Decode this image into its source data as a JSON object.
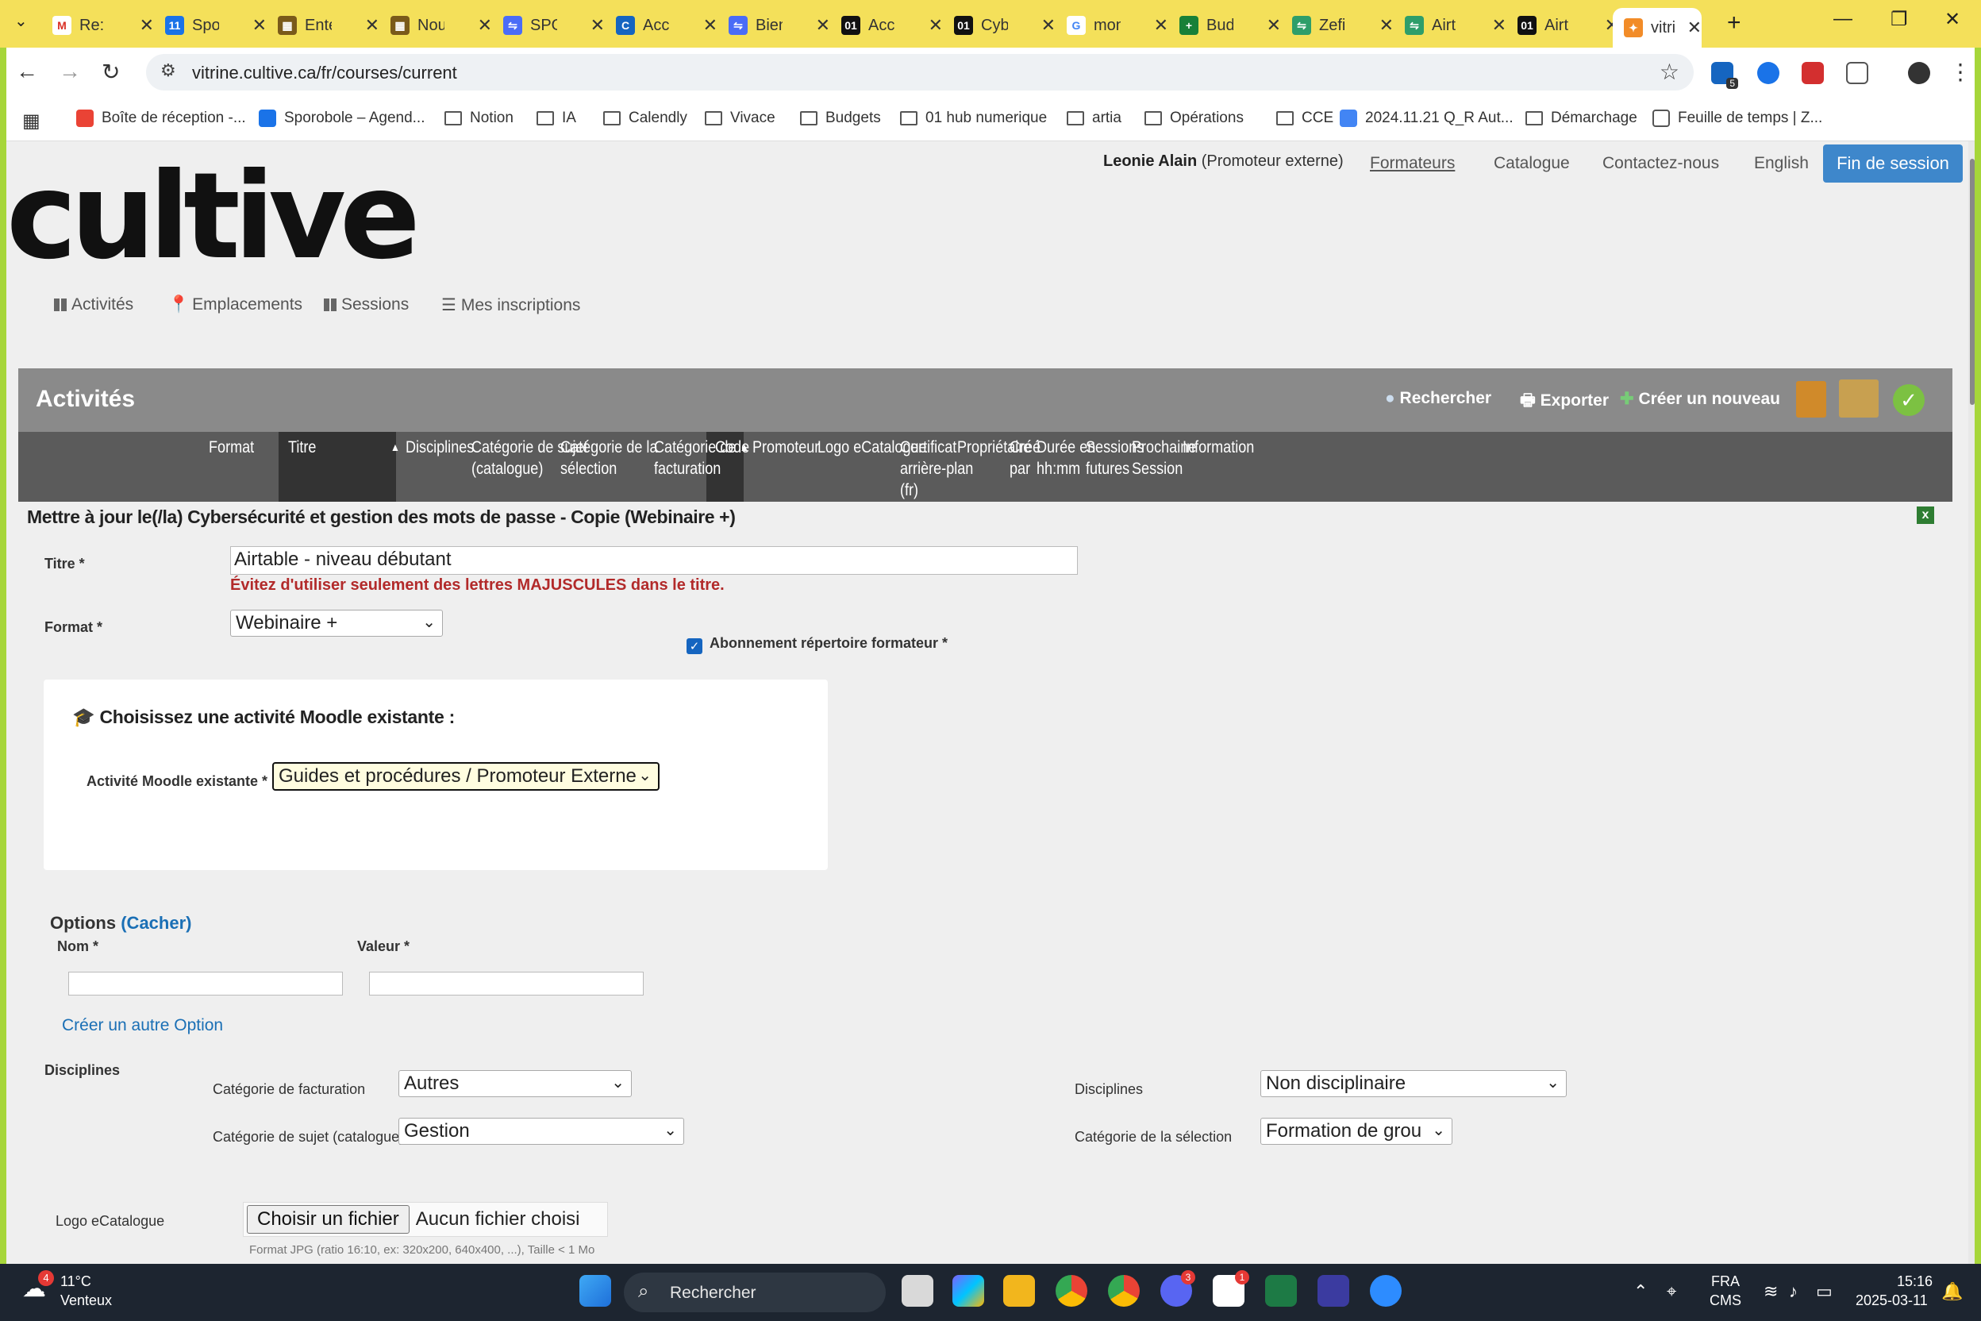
{
  "browser": {
    "tabs": [
      {
        "label": "Re: r",
        "color": "#ffffff",
        "glyph": "M",
        "glyph_color": "#d93025"
      },
      {
        "label": "Spo",
        "color": "#1a73e8",
        "glyph": "11"
      },
      {
        "label": "Ente",
        "color": "#7a5a1a",
        "glyph": "▦"
      },
      {
        "label": "Nou",
        "color": "#7a5a1a",
        "glyph": "▦"
      },
      {
        "label": "SPO",
        "color": "#4a6cf7",
        "glyph": "⇋"
      },
      {
        "label": "Accu",
        "color": "#1565c0",
        "glyph": "C"
      },
      {
        "label": "Bien",
        "color": "#4a6cf7",
        "glyph": "⇋"
      },
      {
        "label": "Accu",
        "color": "#111111",
        "glyph": "01"
      },
      {
        "label": "Cybe",
        "color": "#111111",
        "glyph": "01"
      },
      {
        "label": "mon",
        "color": "#ffffff",
        "glyph": "G",
        "glyph_color": "#4285f4"
      },
      {
        "label": "Bud",
        "color": "#188038",
        "glyph": "+"
      },
      {
        "label": "Zefi",
        "color": "#2e9e6a",
        "glyph": "⇋"
      },
      {
        "label": "Airt",
        "color": "#2e9e6a",
        "glyph": "⇋"
      },
      {
        "label": "Airt",
        "color": "#111111",
        "glyph": "01"
      },
      {
        "label": "vitri",
        "color": "#f28c28",
        "glyph": "✦",
        "active": true
      }
    ],
    "new_tab": "+",
    "url": "vitrine.cultive.ca/fr/courses/current",
    "extension_badge": "5",
    "bookmarks": [
      {
        "label": "Boîte de réception -...",
        "type": "gmail"
      },
      {
        "label": "Sporobole – Agend...",
        "type": "cal"
      },
      {
        "label": "Notion",
        "type": "folder"
      },
      {
        "label": "IA",
        "type": "folder"
      },
      {
        "label": "Calendly",
        "type": "folder"
      },
      {
        "label": "Vivace",
        "type": "folder"
      },
      {
        "label": "Budgets",
        "type": "folder"
      },
      {
        "label": "01 hub numerique",
        "type": "folder"
      },
      {
        "label": "artia",
        "type": "folder"
      },
      {
        "label": "Opérations",
        "type": "folder"
      },
      {
        "label": "CCE",
        "type": "folder"
      },
      {
        "label": "2024.11.21 Q_R Aut...",
        "type": "doc"
      },
      {
        "label": "Démarchage",
        "type": "folder"
      },
      {
        "label": "Feuille de temps | Z...",
        "type": "sheet"
      }
    ]
  },
  "site": {
    "logo": "cultive",
    "user_name": "Leonie Alain",
    "user_role": "(Promoteur externe)",
    "top_links": [
      "Formateurs",
      "Catalogue",
      "Contactez-nous",
      "English"
    ],
    "logout": "Fin de session",
    "nav": [
      "Activités",
      "Emplacements",
      "Sessions",
      "Mes inscriptions"
    ]
  },
  "panel": {
    "title": "Activités",
    "search": "Rechercher",
    "export": "Exporter",
    "create": "Créer un nouveau",
    "columns": [
      [
        "Format"
      ],
      [
        "Titre"
      ],
      [
        "Disciplines"
      ],
      [
        "Catégorie de sujet",
        "(catalogue)"
      ],
      [
        "Catégorie de la",
        "sélection"
      ],
      [
        "Catégorie de",
        "facturation"
      ],
      [
        "Code"
      ],
      [
        "Promoteur"
      ],
      [
        "Logo eCatalogue"
      ],
      [
        "Certificat",
        "arrière-plan",
        "(fr)"
      ],
      [
        "Propriétaire"
      ],
      [
        "Créé",
        "par"
      ],
      [
        "Durée en",
        "hh:mm"
      ],
      [
        "Sessions",
        "futures"
      ],
      [
        "Prochaine",
        "Session"
      ],
      [
        "Information"
      ]
    ]
  },
  "form": {
    "heading": "Mettre à jour le(/la) Cybersécurité et gestion des mots de passe - Copie (Webinaire +)",
    "close": "x",
    "title_label": "Titre *",
    "title_value": "Airtable - niveau débutant",
    "title_warning": "Évitez d'utiliser seulement des lettres MAJUSCULES dans le titre.",
    "format_label": "Format *",
    "format_value": "Webinaire +",
    "subscription_label": "Abonnement répertoire formateur *",
    "subscription_checked": true,
    "moodle_heading": "Choisissez une activité Moodle existante :",
    "moodle_label": "Activité Moodle existante *",
    "moodle_value": "Guides et procédures / Promoteur Externe",
    "options_title": "Options",
    "options_toggle": "(Cacher)",
    "option_name_label": "Nom *",
    "option_value_label": "Valeur *",
    "option_name_value": "",
    "option_value_value": "",
    "create_option": "Créer un autre Option",
    "disciplines_section": "Disciplines",
    "billing_label": "Catégorie de facturation",
    "billing_value": "Autres",
    "subject_label": "Catégorie de sujet (catalogue)",
    "subject_value": "Gestion",
    "disciplines_label": "Disciplines",
    "disciplines_value": "Non disciplinaire",
    "selection_label": "Catégorie de la sélection",
    "selection_value": "Formation de grou",
    "logo_label": "Logo eCatalogue",
    "file_button": "Choisir un fichier",
    "file_none": "Aucun fichier choisi",
    "file_hint": "Format JPG (ratio 16:10, ex: 320x200, 640x400, ...), Taille < 1 Mo"
  },
  "taskbar": {
    "weather_temp": "11°C",
    "weather_desc": "Venteux",
    "weather_badge": "4",
    "search": "Rechercher",
    "lang": "FRA",
    "lang_sub": "CMS",
    "time": "15:16",
    "date": "2025-03-11",
    "discord_badge": "3",
    "notion_badge": "1"
  }
}
